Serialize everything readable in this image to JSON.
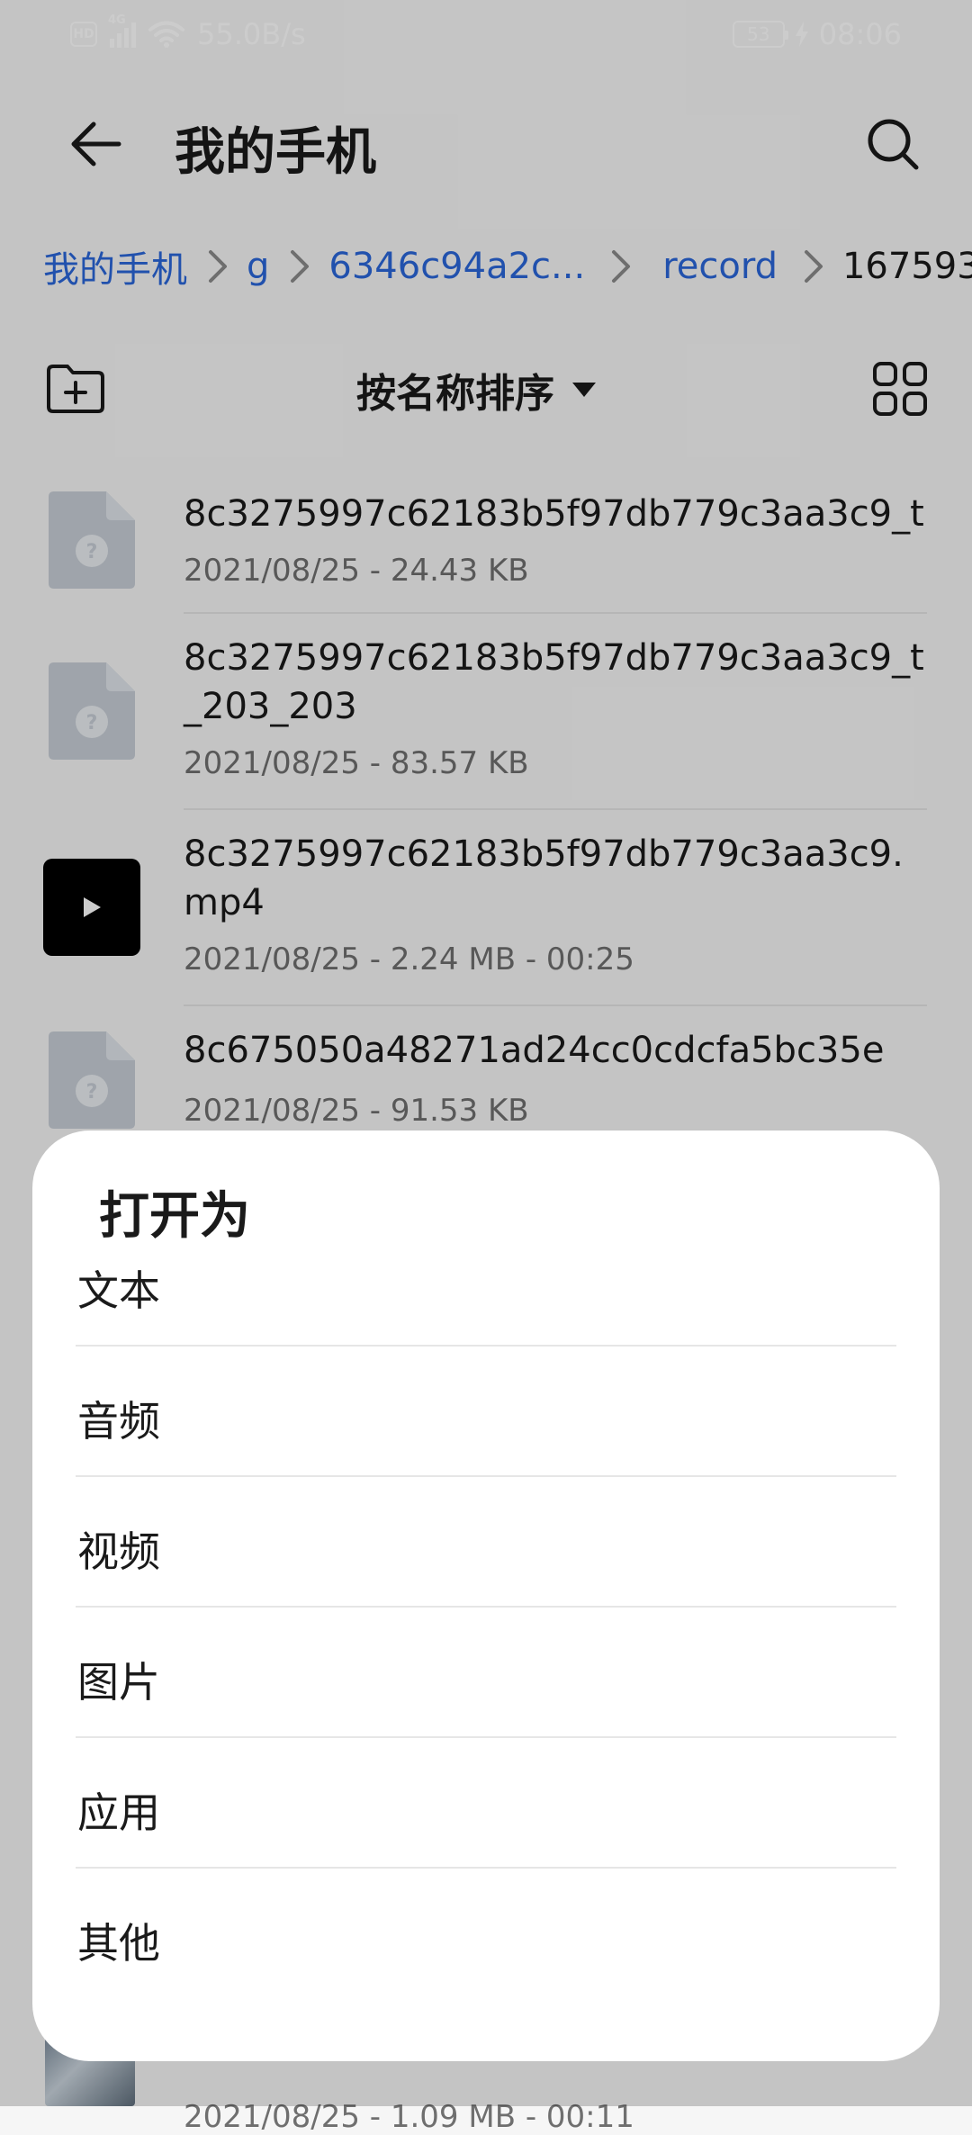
{
  "status_bar": {
    "hd": "HD",
    "network": "4G",
    "speed": "55.0B/s",
    "battery": "53",
    "time": "08:06"
  },
  "header": {
    "title": "我的手机"
  },
  "breadcrumb": [
    "我的手机",
    "g",
    "6346c94a2c...",
    "record",
    "167593"
  ],
  "toolbar": {
    "sort_label": "按名称排序"
  },
  "files": [
    {
      "name": "8c3275997c62183b5f97db779c3aa3c9_t",
      "meta": "2021/08/25 - 24.43 KB",
      "type": "unknown"
    },
    {
      "name": "8c3275997c62183b5f97db779c3aa3c9_t_203_203",
      "meta": "2021/08/25 - 83.57 KB",
      "type": "unknown"
    },
    {
      "name": "8c3275997c62183b5f97db779c3aa3c9.mp4",
      "meta": "2021/08/25 - 2.24 MB - 00:25",
      "type": "video"
    },
    {
      "name": "8c675050a48271ad24cc0cdcfa5bc35e",
      "meta": "2021/08/25 - 91.53 KB",
      "type": "unknown"
    },
    {
      "name": "",
      "meta": "2021/08/25 - 1.09 MB - 00:11",
      "type": "video-thumb"
    }
  ],
  "sheet": {
    "title": "打开为",
    "options": [
      "文本",
      "音频",
      "视频",
      "图片",
      "应用",
      "其他"
    ]
  }
}
